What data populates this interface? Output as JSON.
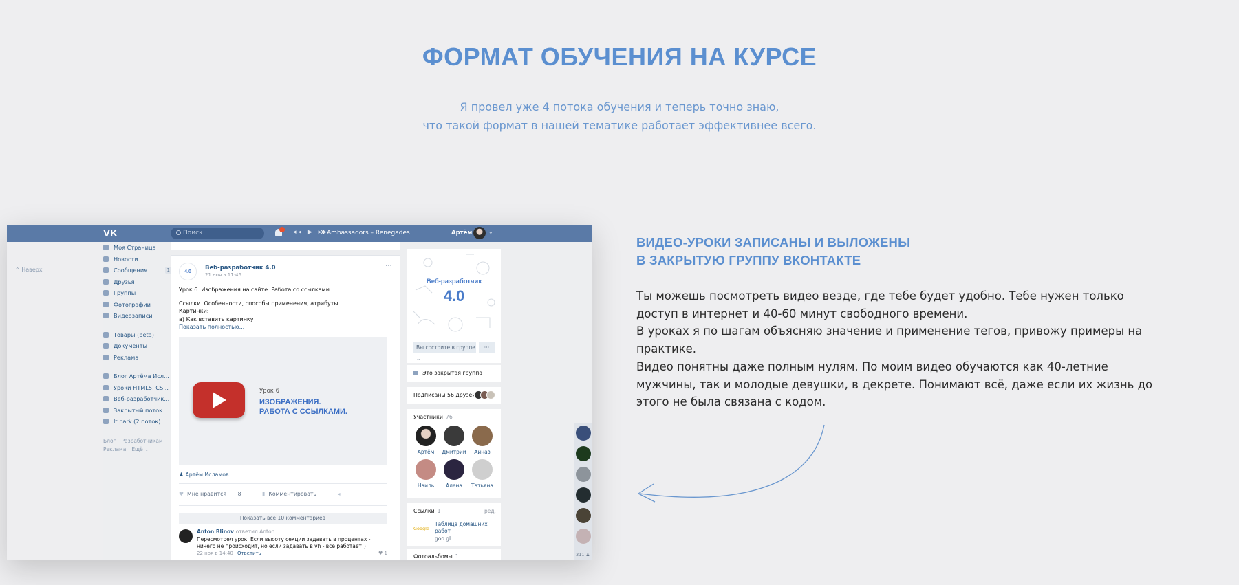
{
  "header": {
    "title": "ФОРМАТ ОБУЧЕНИЯ НА КУРСЕ",
    "subtitle_line1": "Я провел уже 4 потока обучения и теперь точно знаю,",
    "subtitle_line2": "что такой формат в нашей тематике работает эффективнее всего."
  },
  "feature": {
    "heading_line1": "ВИДЕО-УРОКИ ЗАПИСАНЫ И ВЫЛОЖЕНЫ",
    "heading_line2": "В ЗАКРЫТУЮ ГРУППУ ВКОНТАКТЕ",
    "paragraphs": [
      "Ты можешь посмотреть видео везде, где тебе будет удобно. Тебе нужен только доступ в интернет и 40-60 минут свободного времени.",
      "В уроках я по шагам объясняю значение и применение тегов, привожу примеры на практике.",
      "Видео понятны даже полным нулям. По моим видео обучаются как 40-летние мужчины, так и молодые девушки, в декрете. Понимают всё, даже если их жизнь до этого не была связана с кодом."
    ]
  },
  "vk": {
    "logo": "VK",
    "search_placeholder": "Поиск",
    "notif_count": "4",
    "controls": "◂◂ ▶ ▸▸",
    "track": "X Ambassadors – Renegades",
    "user": "Артём",
    "user_arrow": "⌄",
    "back_to_top": "^  Наверх",
    "menu": [
      {
        "label": "Моя Страница",
        "count": ""
      },
      {
        "label": "Новости",
        "count": ""
      },
      {
        "label": "Сообщения",
        "count": "1"
      },
      {
        "label": "Друзья",
        "count": ""
      },
      {
        "label": "Группы",
        "count": ""
      },
      {
        "label": "Фотографии",
        "count": ""
      },
      {
        "label": "Видеозаписи",
        "count": ""
      }
    ],
    "menu2": [
      "Товары (beta)",
      "Документы",
      "Реклама"
    ],
    "menu3": [
      "Блог Артёма Исл...",
      "Уроки HTML5, CS...",
      "Веб-разработчик...",
      "Закрытый поток...",
      "It park (2 поток)"
    ],
    "footer1": [
      "Блог",
      "Разработчикам"
    ],
    "footer2": [
      "Реклама",
      "Ещё ⌄"
    ],
    "post": {
      "avatar_text": "4.0",
      "group_name": "Веб-разработчик 4.0",
      "date": "21 ноя в 11:46",
      "dots": "···",
      "line1": "Урок 6. Изображения на сайте. Работа со ссылками",
      "line2": "Ссылки. Особенности, способы применения, атрибуты.",
      "line3": "Картинки:",
      "line4": "а) Как вставить картинку",
      "more": "Показать полностью...",
      "video_kicker": "Урок 6",
      "video_title1": "ИЗОБРАЖЕНИЯ.",
      "video_title2": "РАБОТА С ССЫЛКАМИ.",
      "author": "Артём Исламов",
      "likes_label": "Мне нравится",
      "likes_count": "8",
      "comment_label": "Комментировать",
      "show_all": "Показать все 10 комментариев",
      "comment": {
        "name": "Anton Blinov",
        "reply": "ответил Anton",
        "text": "Пересмотрел урок. Если высоту секции задавать в процентах - ничего не происходит, но если задавать в vh - все работает!)",
        "date": "22 ноя в 14:40",
        "reply_btn": "Ответить",
        "likes": "1"
      }
    },
    "group_card": {
      "title": "Веб-разработчик",
      "version": "4.0",
      "member_btn": "Вы состоите в группе ⌄",
      "more_btn": "···"
    },
    "closed_group": "Это закрытая группа",
    "friends_subscribed": "Подписаны 56 друзей",
    "members_label": "Участники",
    "members_count": "76",
    "members": [
      "Артём",
      "Дмитрий",
      "Айназ",
      "Наиль",
      "Алена",
      "Татьяна"
    ],
    "links_label": "Ссылки",
    "links_count": "1",
    "links_edit": "ред.",
    "link_icon": "Google",
    "link_title": "Таблица домашних работ",
    "link_url": "goo.gl",
    "albums_label": "Фотоальбомы",
    "albums_count": "1",
    "online_count": "311 ♟"
  }
}
